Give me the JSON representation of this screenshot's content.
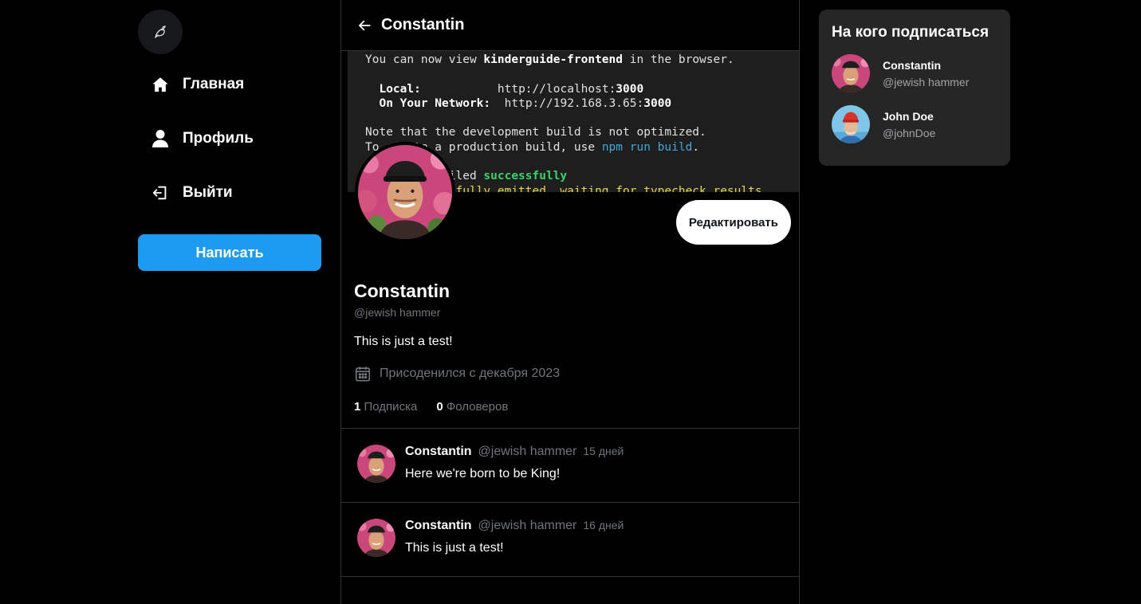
{
  "nav": {
    "logo_icon": "bird-feather-icon",
    "items": [
      {
        "label": "Главная",
        "icon": "home-icon"
      },
      {
        "label": "Профиль",
        "icon": "user-icon"
      },
      {
        "label": "Выйти",
        "icon": "logout-icon"
      }
    ],
    "compose_label": "Написать"
  },
  "header": {
    "title": "Constantin",
    "back_icon": "arrow-left-icon"
  },
  "banner_terminal": {
    "line1_pre": "You can now view ",
    "line1_app": "kinderguide-frontend",
    "line1_post": " in the browser.",
    "local_label": "Local:",
    "local_url_pre": "http://localhost:",
    "local_port": "3000",
    "network_label": "On Your Network:",
    "network_url_pre": "http://192.168.3.65:",
    "network_port": "3000",
    "note1": "Note that the development build is not optimized.",
    "note2_pre": "To create a production build, use ",
    "note2_cmd": "npm run build",
    "note2_post": ".",
    "compiled_pre": "webpack compiled ",
    "compiled_status": "successfully",
    "typecheck": "Files successfully emitted, waiting for typecheck results..."
  },
  "profile": {
    "edit_label": "Редактировать",
    "name": "Constantin",
    "handle": "@jewish hammer",
    "bio": "This is just a test!",
    "joined": "Присоденился с декабря 2023",
    "following_count": "1",
    "following_label": "Подписка",
    "followers_count": "0",
    "followers_label": "Фоловеров"
  },
  "posts": [
    {
      "name": "Constantin",
      "handle": "@jewish hammer",
      "time": "15 дней",
      "text": "Here we're born to be King!"
    },
    {
      "name": "Constantin",
      "handle": "@jewish hammer",
      "time": "16 дней",
      "text": "This is just a test!"
    }
  ],
  "who_to_follow": {
    "title": "На кого подписаться",
    "users": [
      {
        "name": "Constantin",
        "handle": "@jewish hammer"
      },
      {
        "name": "John Doe",
        "handle": "@johnDoe"
      }
    ]
  },
  "colors": {
    "accent": "#1d9bf0",
    "background": "#000000",
    "border": "#2f3336",
    "muted_text": "#71767b",
    "widget_bg": "#262626"
  }
}
